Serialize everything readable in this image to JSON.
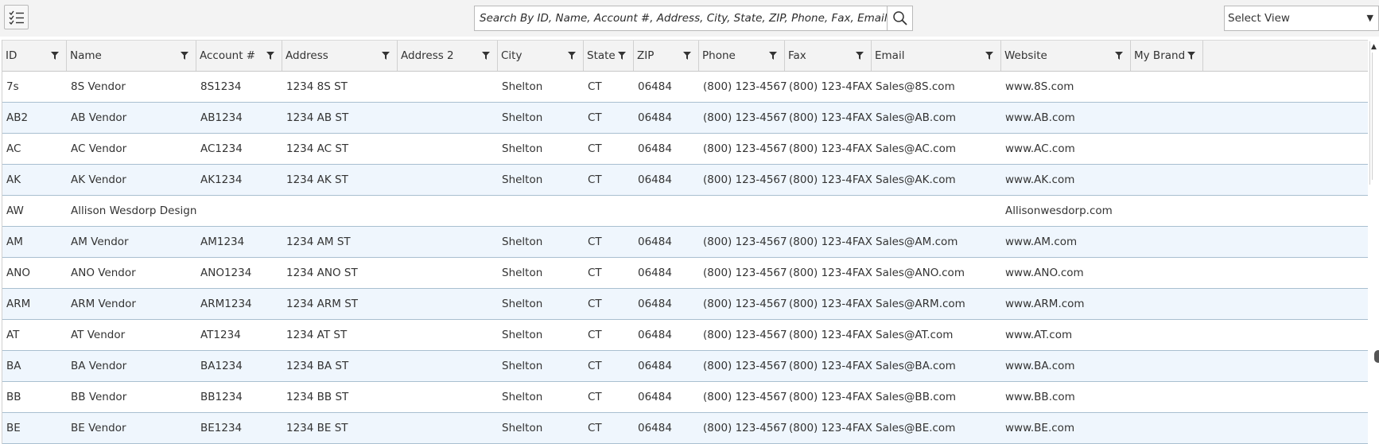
{
  "toolbar": {
    "menu_icon": "checklist-icon",
    "search_placeholder": "Search By ID, Name, Account #, Address, City, State, ZIP, Phone, Fax, Email, Web",
    "search_icon": "search-icon",
    "view_select": "Select View"
  },
  "columns": [
    {
      "key": "id",
      "label": "ID"
    },
    {
      "key": "name",
      "label": "Name"
    },
    {
      "key": "account",
      "label": "Account #"
    },
    {
      "key": "address",
      "label": "Address"
    },
    {
      "key": "address2",
      "label": "Address 2"
    },
    {
      "key": "city",
      "label": "City"
    },
    {
      "key": "state",
      "label": "State"
    },
    {
      "key": "zip",
      "label": "ZIP"
    },
    {
      "key": "phone",
      "label": "Phone"
    },
    {
      "key": "fax",
      "label": "Fax"
    },
    {
      "key": "email",
      "label": "Email"
    },
    {
      "key": "website",
      "label": "Website"
    },
    {
      "key": "brand",
      "label": "My Brand"
    }
  ],
  "rows": [
    {
      "id": "7s",
      "name": "8S Vendor",
      "account": "8S1234",
      "address": "1234 8S ST",
      "address2": "",
      "city": "Shelton",
      "state": "CT",
      "zip": "06484",
      "phone": "(800) 123-4567",
      "fax": "(800) 123-4FAX",
      "email": "Sales@8S.com",
      "website": "www.8S.com",
      "brand": ""
    },
    {
      "id": "AB2",
      "name": "AB Vendor",
      "account": "AB1234",
      "address": "1234 AB ST",
      "address2": "",
      "city": "Shelton",
      "state": "CT",
      "zip": "06484",
      "phone": "(800) 123-4567",
      "fax": "(800) 123-4FAX",
      "email": "Sales@AB.com",
      "website": "www.AB.com",
      "brand": ""
    },
    {
      "id": "AC",
      "name": "AC Vendor",
      "account": "AC1234",
      "address": "1234 AC ST",
      "address2": "",
      "city": "Shelton",
      "state": "CT",
      "zip": "06484",
      "phone": "(800) 123-4567",
      "fax": "(800) 123-4FAX",
      "email": "Sales@AC.com",
      "website": "www.AC.com",
      "brand": ""
    },
    {
      "id": "AK",
      "name": "AK Vendor",
      "account": "AK1234",
      "address": "1234 AK ST",
      "address2": "",
      "city": "Shelton",
      "state": "CT",
      "zip": "06484",
      "phone": "(800) 123-4567",
      "fax": "(800) 123-4FAX",
      "email": "Sales@AK.com",
      "website": "www.AK.com",
      "brand": ""
    },
    {
      "id": "AW",
      "name": "Allison Wesdorp Design",
      "account": "",
      "address": "",
      "address2": "",
      "city": "",
      "state": "",
      "zip": "",
      "phone": "",
      "fax": "",
      "email": "",
      "website": "Allisonwesdorp.com",
      "brand": ""
    },
    {
      "id": "AM",
      "name": "AM Vendor",
      "account": "AM1234",
      "address": "1234 AM ST",
      "address2": "",
      "city": "Shelton",
      "state": "CT",
      "zip": "06484",
      "phone": "(800) 123-4567",
      "fax": "(800) 123-4FAX",
      "email": "Sales@AM.com",
      "website": "www.AM.com",
      "brand": ""
    },
    {
      "id": "ANO",
      "name": "ANO Vendor",
      "account": "ANO1234",
      "address": "1234 ANO ST",
      "address2": "",
      "city": "Shelton",
      "state": "CT",
      "zip": "06484",
      "phone": "(800) 123-4567",
      "fax": "(800) 123-4FAX",
      "email": "Sales@ANO.com",
      "website": "www.ANO.com",
      "brand": ""
    },
    {
      "id": "ARM",
      "name": "ARM Vendor",
      "account": "ARM1234",
      "address": "1234 ARM ST",
      "address2": "",
      "city": "Shelton",
      "state": "CT",
      "zip": "06484",
      "phone": "(800) 123-4567",
      "fax": "(800) 123-4FAX",
      "email": "Sales@ARM.com",
      "website": "www.ARM.com",
      "brand": ""
    },
    {
      "id": "AT",
      "name": "AT Vendor",
      "account": "AT1234",
      "address": "1234 AT ST",
      "address2": "",
      "city": "Shelton",
      "state": "CT",
      "zip": "06484",
      "phone": "(800) 123-4567",
      "fax": "(800) 123-4FAX",
      "email": "Sales@AT.com",
      "website": "www.AT.com",
      "brand": ""
    },
    {
      "id": "BA",
      "name": "BA Vendor",
      "account": "BA1234",
      "address": "1234 BA ST",
      "address2": "",
      "city": "Shelton",
      "state": "CT",
      "zip": "06484",
      "phone": "(800) 123-4567",
      "fax": "(800) 123-4FAX",
      "email": "Sales@BA.com",
      "website": "www.BA.com",
      "brand": ""
    },
    {
      "id": "BB",
      "name": "BB Vendor",
      "account": "BB1234",
      "address": "1234 BB ST",
      "address2": "",
      "city": "Shelton",
      "state": "CT",
      "zip": "06484",
      "phone": "(800) 123-4567",
      "fax": "(800) 123-4FAX",
      "email": "Sales@BB.com",
      "website": "www.BB.com",
      "brand": ""
    },
    {
      "id": "BE",
      "name": "BE Vendor",
      "account": "BE1234",
      "address": "1234 BE ST",
      "address2": "",
      "city": "Shelton",
      "state": "CT",
      "zip": "06484",
      "phone": "(800) 123-4567",
      "fax": "(800) 123-4FAX",
      "email": "Sales@BE.com",
      "website": "www.BE.com",
      "brand": ""
    }
  ]
}
